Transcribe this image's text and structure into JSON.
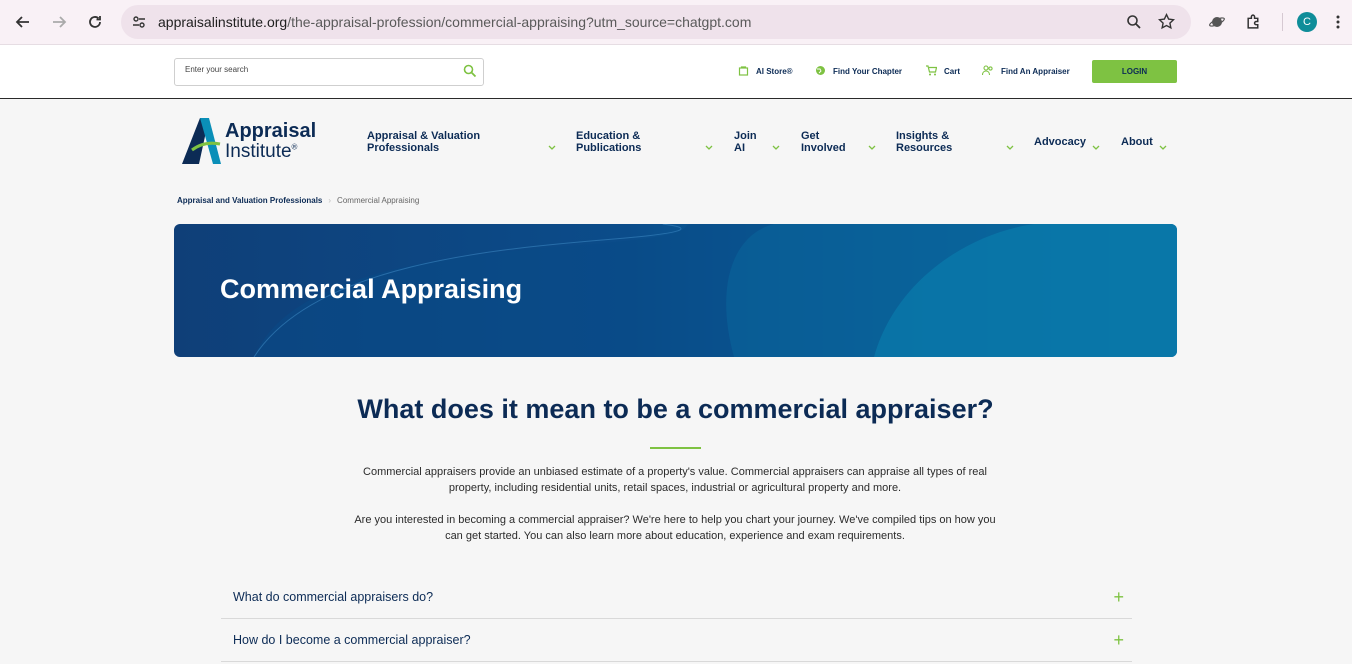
{
  "browser": {
    "url_host": "appraisalinstitute.org",
    "url_path": "/the-appraisal-profession/commercial-appraising?utm_source=chatgpt.com",
    "profile_initial": "C"
  },
  "utility": {
    "search_placeholder": "Enter your search",
    "ai_store": "AI Store®",
    "find_chapter": "Find Your Chapter",
    "cart": "Cart",
    "find_appraiser": "Find An Appraiser",
    "login": "LOGIN"
  },
  "logo": {
    "line1": "Appraisal",
    "line2": "Institute",
    "mark": "®"
  },
  "nav": {
    "items": [
      {
        "l1": "Appraisal & Valuation",
        "l2": "Professionals"
      },
      {
        "l1": "Education &",
        "l2": "Publications"
      },
      {
        "l1": "Join",
        "l2": "AI"
      },
      {
        "l1": "Get",
        "l2": "Involved"
      },
      {
        "l1": "Insights &",
        "l2": "Resources"
      },
      {
        "l1": "Advocacy",
        "l2": ""
      },
      {
        "l1": "About",
        "l2": ""
      }
    ]
  },
  "breadcrumb": {
    "parent": "Appraisal and Valuation Professionals",
    "separator": "›",
    "current": "Commercial Appraising"
  },
  "hero": {
    "title": "Commercial Appraising"
  },
  "content": {
    "heading": "What does it mean to be a commercial appraiser?",
    "p1a": "Commercial appraisers provide an unbiased estimate of a property's value. Commercial appraisers can appraise all types of real",
    "p1b": "property, including residential units, retail spaces, industrial or agricultural property and more.",
    "p2a": "Are you interested in becoming a commercial appraiser? We're here to help you chart your journey. We've compiled tips on how you",
    "p2b": "can get started. You can also learn more about education, experience and exam requirements."
  },
  "accordion": [
    {
      "question": "What do commercial appraisers do?",
      "icon": "+"
    },
    {
      "question": "How do I become a commercial appraiser?",
      "icon": "+"
    }
  ],
  "colors": {
    "navy": "#0c2b55",
    "green": "#7ec242",
    "hero_start": "#0f3f78",
    "hero_end": "#0a8fb8"
  }
}
